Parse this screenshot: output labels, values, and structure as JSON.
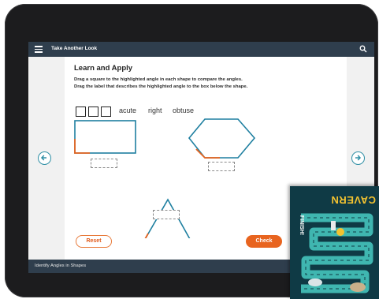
{
  "header": {
    "title": "Take Another Look",
    "menu_icon": "hamburger-icon",
    "search_icon": "search-icon"
  },
  "lesson": {
    "heading": "Learn and Apply",
    "instruction_1": "Drag a square to the highlighted angle in each shape to compare the angles.",
    "instruction_2": "Drag the label that describes the highlighted angle to the box below the shape."
  },
  "labels": [
    "acute",
    "right",
    "obtuse"
  ],
  "buttons": {
    "reset": "Reset",
    "check": "Check"
  },
  "footer": {
    "title": "Identify Angles in Shapes"
  },
  "game_card": {
    "title": "CAVERN",
    "finish": "FINISH!"
  },
  "colors": {
    "shape_stroke": "#1e7fa0",
    "highlight": "#e8641f",
    "bar": "#2f3e4d",
    "button": "#e8641f"
  }
}
